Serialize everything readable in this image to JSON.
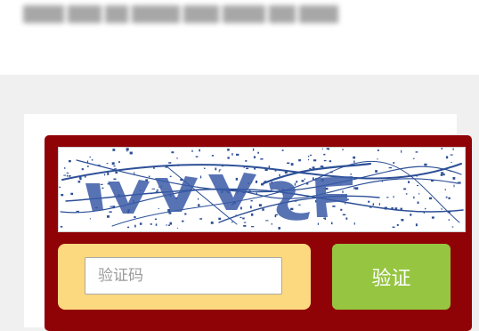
{
  "captcha": {
    "input_placeholder": "验证码",
    "verify_label": "验证"
  },
  "colors": {
    "panel": "#8f0206",
    "input_frame": "#fcd87e",
    "verify_button": "#96c541",
    "captcha_ink": "#2c4f97"
  }
}
